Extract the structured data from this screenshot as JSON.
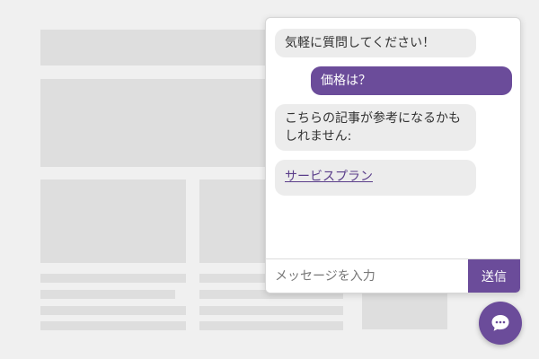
{
  "chat": {
    "messages": [
      {
        "sender": "bot",
        "text": "気軽に質問してください！"
      },
      {
        "sender": "user",
        "text": "価格は？"
      },
      {
        "sender": "bot",
        "text": "こちらの記事が参考になるかもしれません:"
      },
      {
        "sender": "bot",
        "link_text": "サービスプラン"
      }
    ],
    "input_placeholder": "メッセージを入力",
    "send_label": "送信"
  },
  "launcher": {
    "icon": "chat-bubble-icon"
  },
  "colors": {
    "accent": "#6b4c9a",
    "bot_bubble": "#ececec",
    "placeholder_block": "#dedede"
  }
}
